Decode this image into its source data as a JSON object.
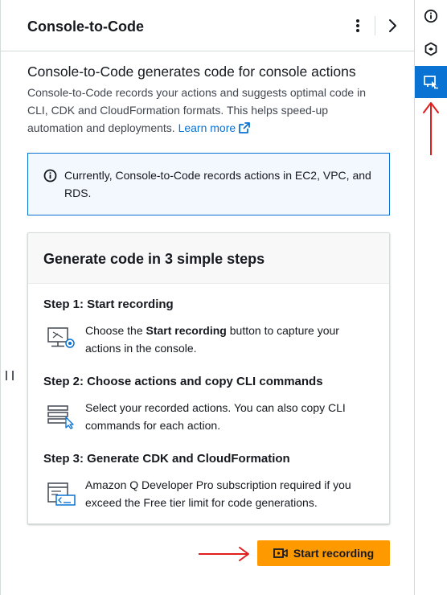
{
  "panel": {
    "title": "Console-to-Code"
  },
  "intro": {
    "title": "Console-to-Code generates code for console actions",
    "description": "Console-to-Code records your actions and suggests optimal code in CLI, CDK and CloudFormation formats. This helps speed-up automation and deployments.",
    "learn_more": "Learn more"
  },
  "alert": {
    "text": "Currently, Console-to-Code records actions in EC2, VPC, and RDS."
  },
  "steps_card": {
    "title": "Generate code in 3 simple steps",
    "steps": [
      {
        "title": "Step 1: Start recording",
        "desc_before": "Choose the ",
        "desc_bold": "Start recording",
        "desc_after": " button to capture your actions in the console.",
        "icon": "monitor-record-icon"
      },
      {
        "title": "Step 2: Choose actions and copy CLI commands",
        "desc": "Select your recorded actions. You can also copy CLI commands for each action.",
        "icon": "list-select-icon"
      },
      {
        "title": "Step 3: Generate CDK and CloudFormation",
        "desc": "Amazon Q Developer Pro subscription required if you exceed the Free tier limit for code generations.",
        "icon": "code-window-icon"
      }
    ]
  },
  "start_button": {
    "label": "Start recording",
    "icon": "video-camera-icon"
  },
  "rail": {
    "items": [
      {
        "icon": "info-icon",
        "active": false
      },
      {
        "icon": "hexagon-icon",
        "active": false
      },
      {
        "icon": "console-to-code-icon",
        "active": true
      }
    ]
  },
  "colors": {
    "accent": "#0972d3",
    "button": "#ff9900",
    "annotation_arrow": "#e01e1e",
    "alert_bg": "#f2f8fd"
  }
}
